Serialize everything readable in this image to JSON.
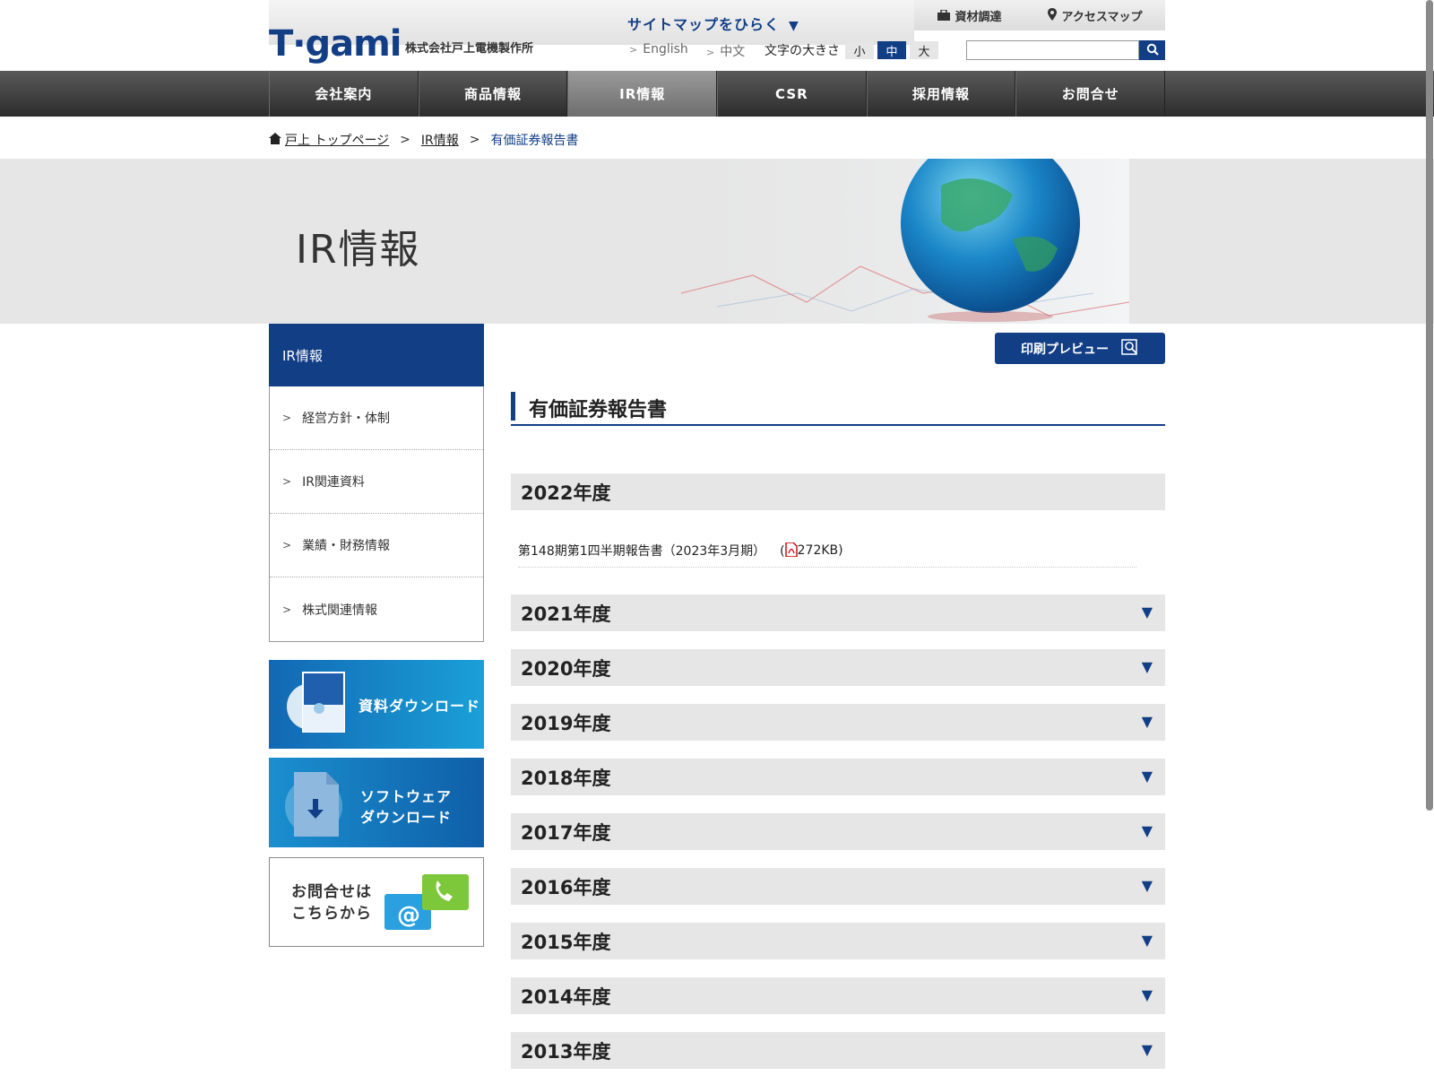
{
  "header": {
    "logo_text": "T·gami",
    "company_name": "株式会社戸上電機製作所",
    "sitemap_label": "サイトマップをひらく",
    "utility": [
      {
        "label": "資材調達",
        "icon": "briefcase-icon"
      },
      {
        "label": "アクセスマップ",
        "icon": "map-pin-icon"
      }
    ],
    "languages": [
      "English",
      "中文"
    ],
    "font_size_label": "文字の大きさ",
    "font_sizes": [
      "小",
      "中",
      "大"
    ],
    "font_size_selected": "中",
    "search_placeholder": ""
  },
  "nav": {
    "items": [
      "会社案内",
      "商品情報",
      "IR情報",
      "CSR",
      "採用情報",
      "お問合せ"
    ],
    "active": "IR情報"
  },
  "breadcrumb": [
    "戸上 トップページ",
    "IR情報",
    "有価証券報告書"
  ],
  "banner": {
    "title": "IR情報"
  },
  "sidebar": {
    "heading": "IR情報",
    "items": [
      "経営方針・体制",
      "IR関連資料",
      "業績・財務情報",
      "株式関連情報"
    ],
    "banners": {
      "download": "資料ダウンロード",
      "software_line1": "ソフトウェア",
      "software_line2": "ダウンロード",
      "contact_line1": "お問合せは",
      "contact_line2": "こちらから"
    }
  },
  "main": {
    "print_label": "印刷プレビュー",
    "title": "有価証券報告書",
    "years": [
      {
        "label": "2022年度",
        "expanded": true,
        "docs": [
          {
            "title": "第148期第1四半期報告書（2023年3月期）",
            "size": "272KB"
          }
        ]
      },
      {
        "label": "2021年度",
        "expanded": false
      },
      {
        "label": "2020年度",
        "expanded": false
      },
      {
        "label": "2019年度",
        "expanded": false
      },
      {
        "label": "2018年度",
        "expanded": false
      },
      {
        "label": "2017年度",
        "expanded": false
      },
      {
        "label": "2016年度",
        "expanded": false
      },
      {
        "label": "2015年度",
        "expanded": false
      },
      {
        "label": "2014年度",
        "expanded": false
      },
      {
        "label": "2013年度",
        "expanded": false
      }
    ],
    "expand_icon": "triangle-down-icon"
  },
  "colors": {
    "brand_blue": "#123e86",
    "panel_gray": "#e6e6e6",
    "nav_dark": "#3a3a3a"
  }
}
